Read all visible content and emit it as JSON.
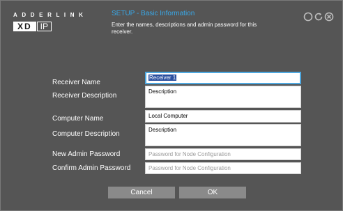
{
  "logo": {
    "brand": "ADDERLINK",
    "xd": "XD",
    "ip": "IP"
  },
  "header": {
    "title": "SETUP - Basic Information",
    "description": "Enter the names, descriptions and admin password for this receiver."
  },
  "icons": [
    "circle-icon",
    "refresh-icon",
    "close-icon"
  ],
  "form": {
    "receiver_name": {
      "label": "Receiver Name",
      "value": "Receiver 1"
    },
    "receiver_description": {
      "label": "Receiver Description",
      "value": "Description"
    },
    "computer_name": {
      "label": "Computer Name",
      "value": "Local Computer"
    },
    "computer_description": {
      "label": "Computer Description",
      "value": "Description"
    },
    "new_admin_password": {
      "label": "New Admin Password",
      "placeholder": "Password for Node Configuration"
    },
    "confirm_admin_password": {
      "label": "Confirm Admin Password",
      "placeholder": "Password for Node Configuration"
    }
  },
  "buttons": {
    "cancel": "Cancel",
    "ok": "OK"
  },
  "colors": {
    "accent": "#39a8e8",
    "background": "#555555",
    "button": "#8a8a8a"
  }
}
